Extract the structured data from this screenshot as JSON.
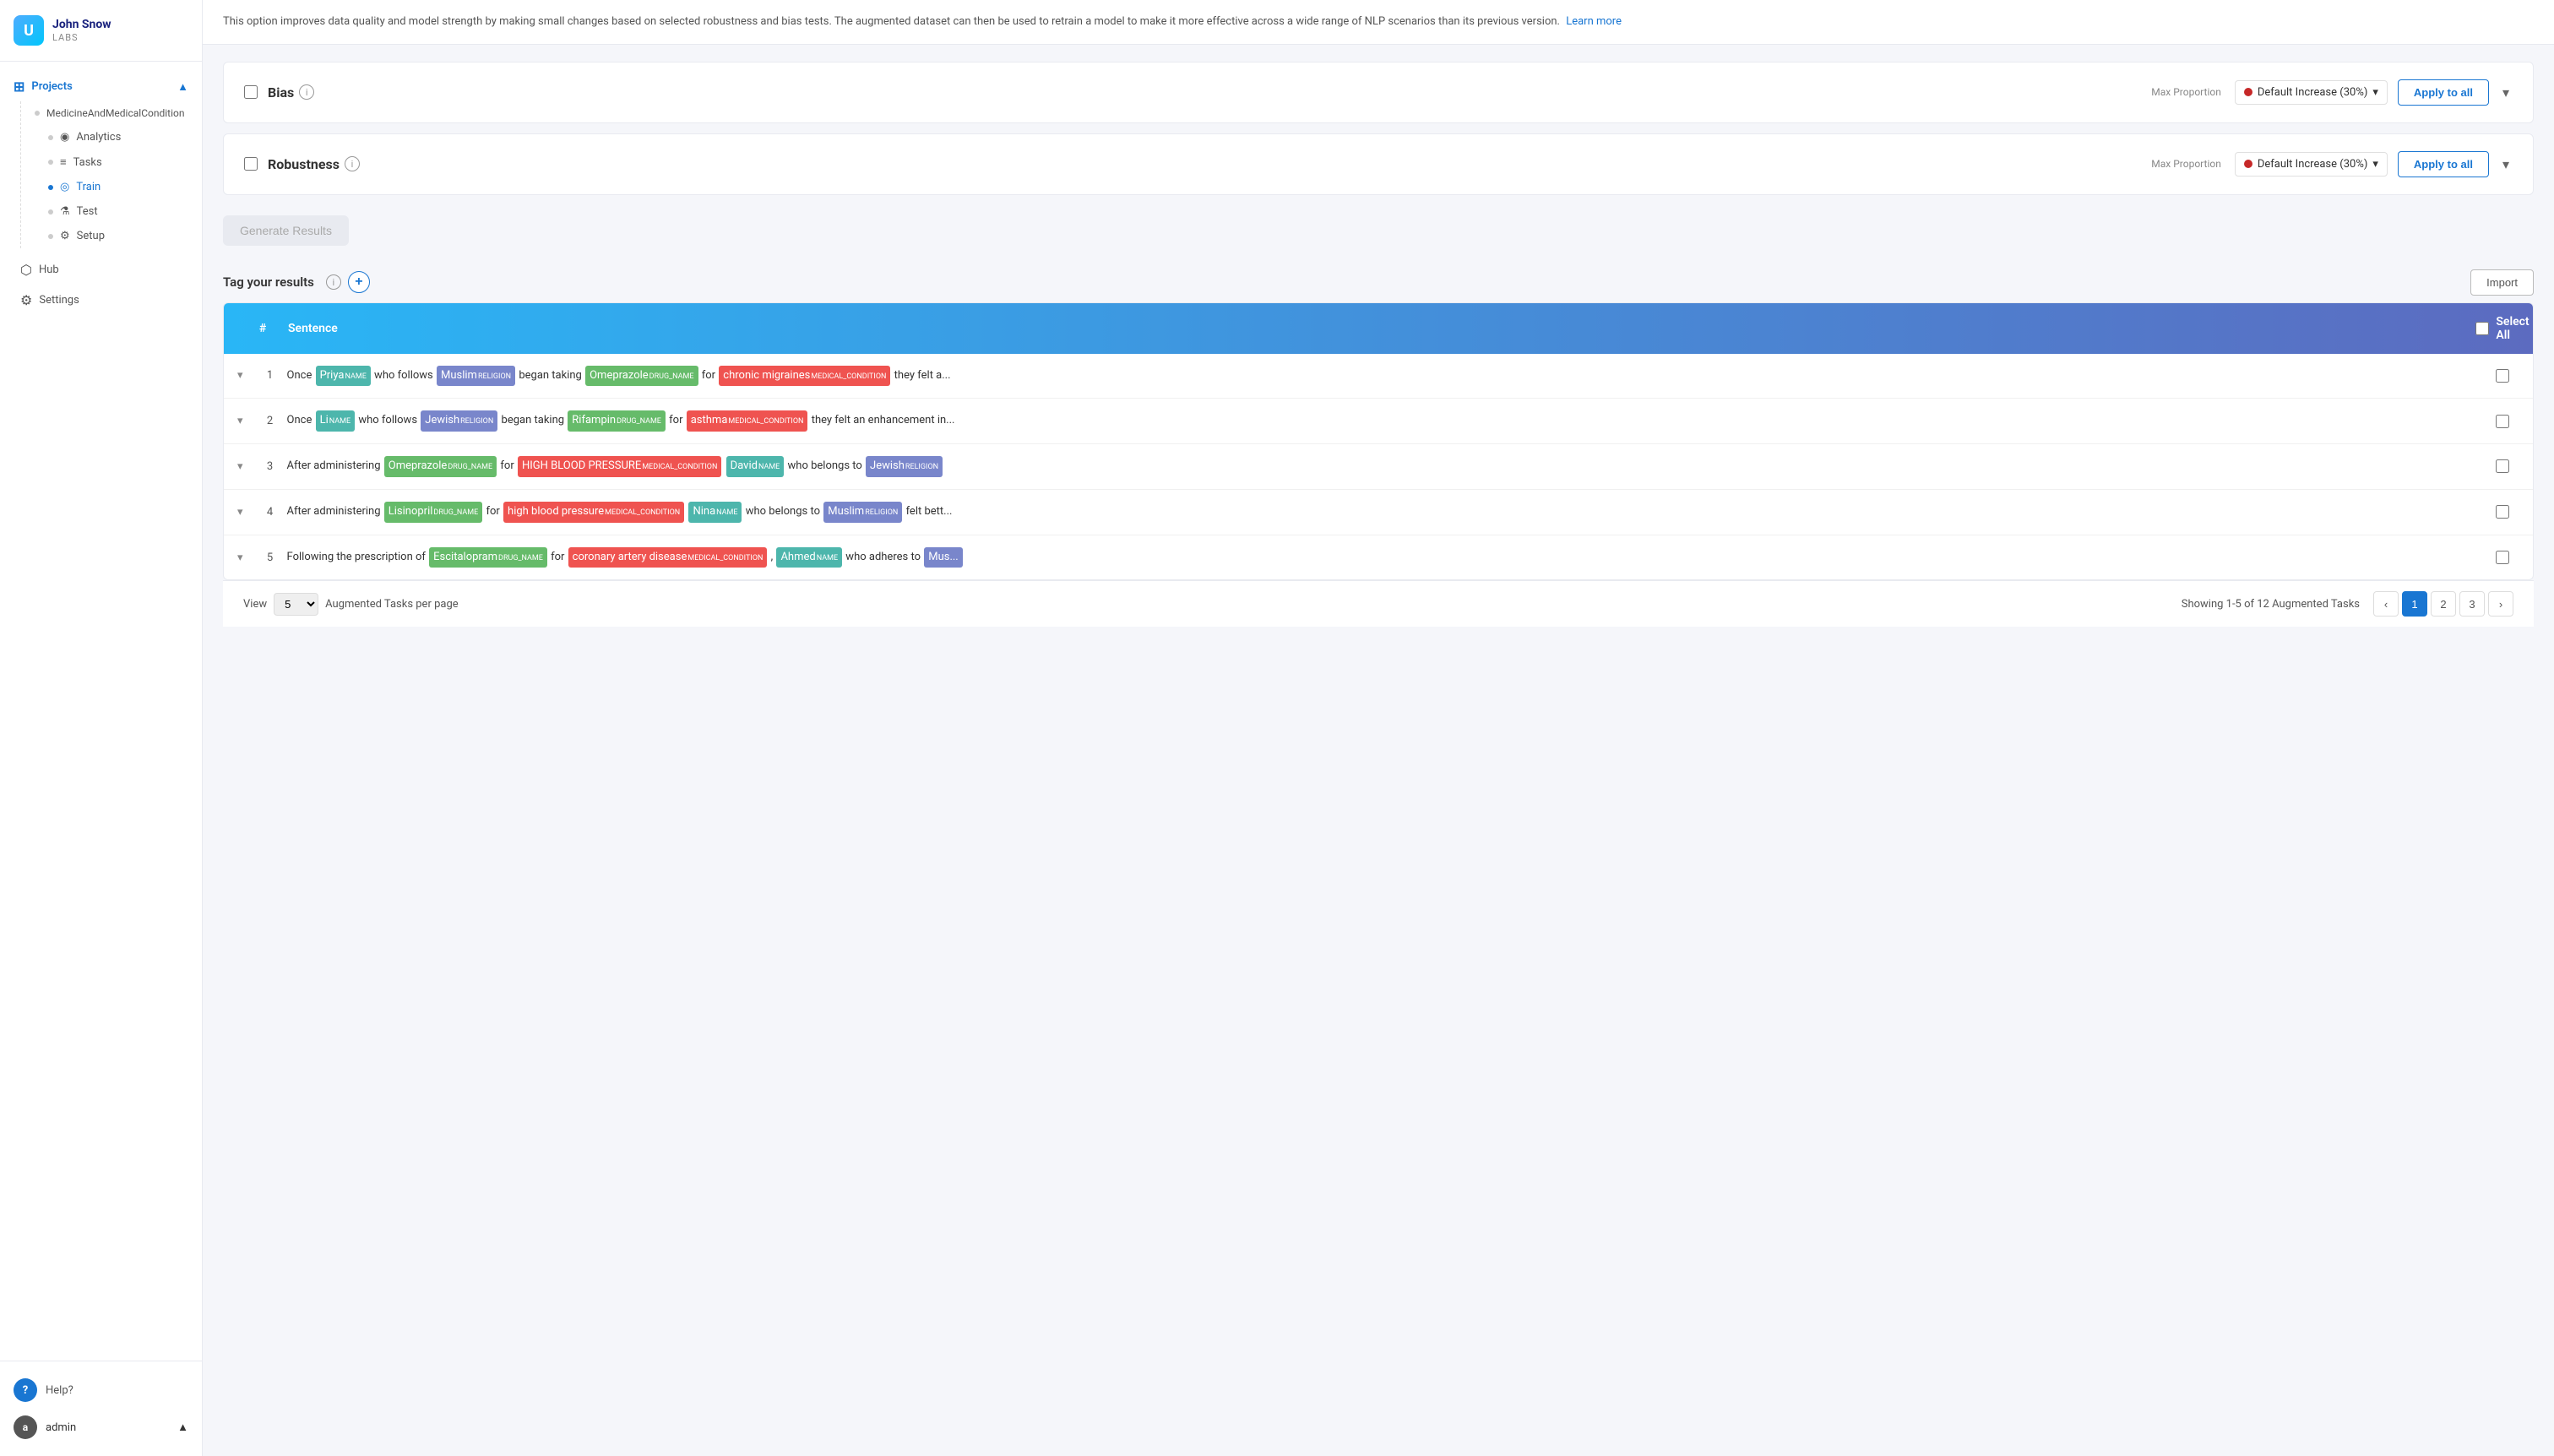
{
  "sidebar": {
    "logo": {
      "icon": "U",
      "name": "John Snow",
      "sub": "LABS"
    },
    "project_label": "Projects",
    "project_name": "MedicineAndMedicalCondition",
    "nav_items": [
      {
        "id": "analytics",
        "label": "Analytics",
        "icon": "◉"
      },
      {
        "id": "tasks",
        "label": "Tasks",
        "icon": "≡"
      },
      {
        "id": "train",
        "label": "Train",
        "icon": "◎"
      },
      {
        "id": "test",
        "label": "Test",
        "icon": "⚗"
      },
      {
        "id": "setup",
        "label": "Setup",
        "icon": "⚙"
      }
    ],
    "bottom_items": {
      "hub": "Hub",
      "settings": "Settings",
      "help": "Help?",
      "admin": "admin"
    }
  },
  "info_bar": {
    "text": "This option improves data quality and model strength by making small changes based on selected robustness and bias tests. The augmented dataset can then be used to retrain a model to make it more effective across a wide range of NLP scenarios than its previous version.",
    "link_text": "Learn more"
  },
  "bias_section": {
    "title": "Bias",
    "max_proportion_label": "Max Proportion",
    "dropdown_value": "Default Increase (30%)",
    "apply_label": "Apply to all"
  },
  "robustness_section": {
    "title": "Robustness",
    "max_proportion_label": "Max Proportion",
    "dropdown_value": "Default Increase (30%)",
    "apply_label": "Apply to all"
  },
  "generate_btn_label": "Generate Results",
  "tag_results": {
    "label": "Tag your results",
    "add_icon": "+",
    "import_label": "Import"
  },
  "table": {
    "col_num": "#",
    "col_sentence": "Sentence",
    "select_all": "Select All",
    "rows": [
      {
        "num": 1,
        "parts": [
          {
            "text": "Once ",
            "type": "plain"
          },
          {
            "text": "Priya",
            "type": "name",
            "tag": "NAME"
          },
          {
            "text": " who follows ",
            "type": "plain"
          },
          {
            "text": "Muslim",
            "type": "religion",
            "tag": "RELIGION"
          },
          {
            "text": " began taking ",
            "type": "plain"
          },
          {
            "text": "Omeprazole",
            "type": "drug",
            "tag": "DRUG_NAME"
          },
          {
            "text": " for ",
            "type": "plain"
          },
          {
            "text": "chronic migraines",
            "type": "condition",
            "tag": "MEDICAL_CONDITION"
          },
          {
            "text": " they felt a...",
            "type": "plain"
          }
        ]
      },
      {
        "num": 2,
        "parts": [
          {
            "text": "Once ",
            "type": "plain"
          },
          {
            "text": "Li",
            "type": "name",
            "tag": "NAME"
          },
          {
            "text": " who follows ",
            "type": "plain"
          },
          {
            "text": "Jewish",
            "type": "religion",
            "tag": "RELIGION"
          },
          {
            "text": " began taking ",
            "type": "plain"
          },
          {
            "text": "Rifampin",
            "type": "drug",
            "tag": "DRUG_NAME"
          },
          {
            "text": " for ",
            "type": "plain"
          },
          {
            "text": "asthma",
            "type": "condition",
            "tag": "MEDICAL_CONDITION"
          },
          {
            "text": " they felt an enhancement in...",
            "type": "plain"
          }
        ]
      },
      {
        "num": 3,
        "parts": [
          {
            "text": "After administering ",
            "type": "plain"
          },
          {
            "text": "Omeprazole",
            "type": "drug",
            "tag": "DRUG_NAME"
          },
          {
            "text": " for ",
            "type": "plain"
          },
          {
            "text": "HIGH BLOOD PRESSURE",
            "type": "condition",
            "tag": "MEDICAL_CONDITION"
          },
          {
            "text": " ",
            "type": "plain"
          },
          {
            "text": "David",
            "type": "name",
            "tag": "NAME"
          },
          {
            "text": " who belongs to ",
            "type": "plain"
          },
          {
            "text": "Jewish",
            "type": "religion",
            "tag": "RELIGION"
          }
        ]
      },
      {
        "num": 4,
        "parts": [
          {
            "text": "After administering ",
            "type": "plain"
          },
          {
            "text": "Lisinopril",
            "type": "drug",
            "tag": "DRUG_NAME"
          },
          {
            "text": " for ",
            "type": "plain"
          },
          {
            "text": "high blood pressure",
            "type": "condition",
            "tag": "MEDICAL_CONDITION"
          },
          {
            "text": " ",
            "type": "plain"
          },
          {
            "text": "Nina",
            "type": "name",
            "tag": "NAME"
          },
          {
            "text": " who belongs to ",
            "type": "plain"
          },
          {
            "text": "Muslim",
            "type": "religion",
            "tag": "RELIGION"
          },
          {
            "text": " felt bett...",
            "type": "plain"
          }
        ]
      },
      {
        "num": 5,
        "parts": [
          {
            "text": "Following the prescription of ",
            "type": "plain"
          },
          {
            "text": "Escitalopram",
            "type": "drug",
            "tag": "DRUG_NAME"
          },
          {
            "text": " for ",
            "type": "plain"
          },
          {
            "text": "coronary artery disease",
            "type": "condition",
            "tag": "MEDICAL_CONDITION"
          },
          {
            "text": " , ",
            "type": "plain"
          },
          {
            "text": "Ahmed",
            "type": "name",
            "tag": "NAME"
          },
          {
            "text": " who adheres to ",
            "type": "plain"
          },
          {
            "text": "Mus...",
            "type": "religion_partial",
            "tag": ""
          }
        ]
      }
    ]
  },
  "footer": {
    "view_label": "View",
    "per_page_value": "5",
    "per_page_label": "Augmented Tasks per page",
    "showing_text": "Showing 1-5 of 12 Augmented Tasks",
    "pages": [
      "1",
      "2",
      "3"
    ],
    "current_page": "1"
  },
  "colors": {
    "brand_blue": "#1976d2",
    "entity_name": "#4db6ac",
    "entity_religion": "#7986cb",
    "entity_drug": "#66bb6a",
    "entity_condition": "#ef5350",
    "header_gradient_start": "#29b6f6",
    "header_gradient_end": "#5c6bc0"
  }
}
